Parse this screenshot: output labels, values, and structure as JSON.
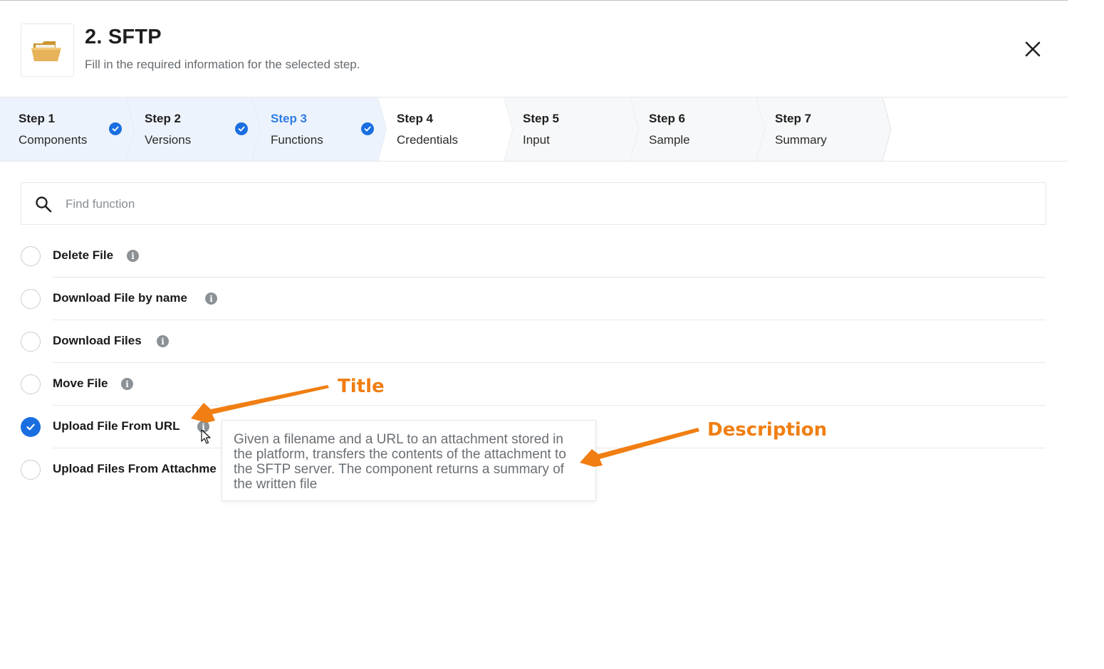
{
  "header": {
    "title": "2. SFTP",
    "subtitle": "Fill in the required information for the selected step.",
    "logo_icon": "folder-icon",
    "close_icon": "close-icon"
  },
  "stepper": {
    "steps": [
      {
        "num": "Step 1",
        "name": "Components",
        "done": true,
        "active": false
      },
      {
        "num": "Step 2",
        "name": "Versions",
        "done": true,
        "active": false
      },
      {
        "num": "Step 3",
        "name": "Functions",
        "done": true,
        "active": true
      },
      {
        "num": "Step 4",
        "name": "Credentials",
        "done": false,
        "active": false
      },
      {
        "num": "Step 5",
        "name": "Input",
        "done": false,
        "active": false
      },
      {
        "num": "Step 6",
        "name": "Sample",
        "done": false,
        "active": false
      },
      {
        "num": "Step 7",
        "name": "Summary",
        "done": false,
        "active": false
      }
    ]
  },
  "search": {
    "placeholder": "Find function",
    "value": ""
  },
  "functions": [
    {
      "label": "Delete File",
      "selected": false
    },
    {
      "label": "Download File by name",
      "selected": false
    },
    {
      "label": "Download Files",
      "selected": false
    },
    {
      "label": "Move File",
      "selected": false
    },
    {
      "label": "Upload File From URL",
      "selected": true
    },
    {
      "label": "Upload Files From Attachme",
      "selected": false
    }
  ],
  "tooltip": {
    "text": "Given a filename and a URL to an attachment stored in the platform, transfers the contents of the attachment to the SFTP server. The component returns a summary of the written file"
  },
  "annotations": {
    "title_label": "Title",
    "description_label": "Description",
    "color": "#f07e12"
  },
  "colors": {
    "accent": "#1a6fe0",
    "active_step_text": "#2f7de1",
    "completed_step_bg": "#edf3fc",
    "pending_step_bg": "#f7f8f9"
  }
}
